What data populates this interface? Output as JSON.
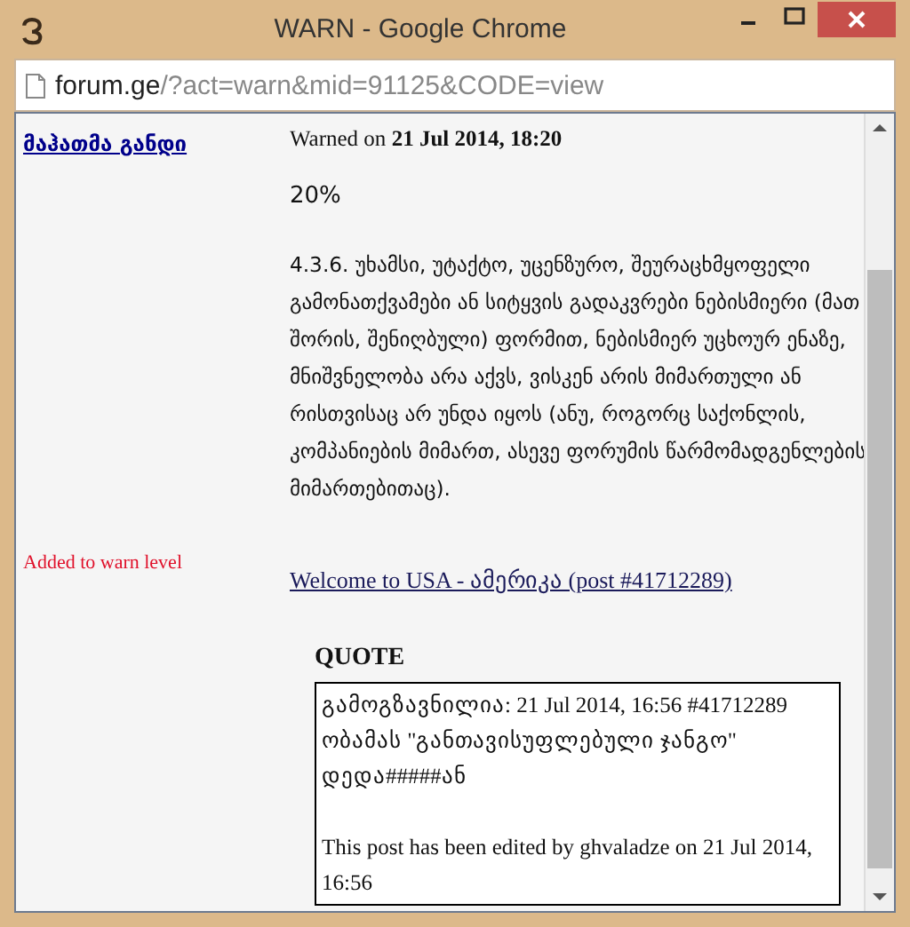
{
  "window": {
    "title": "WARN - Google Chrome"
  },
  "address_bar": {
    "domain": "forum.ge",
    "path": "/?act=warn&mid=91125&CODE=view"
  },
  "warning": {
    "user": "მაჰათმა განდი",
    "warned_label": "Warned on",
    "warned_date": "21 Jul 2014, 18:20",
    "level_text": "20%",
    "reason": "4.3.6. უხამსი, უტაქტო, უცენზურო, შეურაცხმყოფელი გამონათქვამები ან სიტყვის გადაკვრები ნებისმიერი (მათ შორის, შენიღბული) ფორმით, ნებისმიერ უცხოურ ენაზე, მნიშვნელობა არა აქვს, ვისკენ არის მიმართული ან რისთვისაც არ უნდა იყოს (ანუ, როგორც საქონლის, კომპანიების მიმართ, ასევე ფორუმის წარმომადგენლების მიმართებითაც).",
    "added_note": "Added to warn level",
    "post_link": "Welcome to USA - ამერიკა (post #41712289)",
    "quote": {
      "title": "QUOTE",
      "lines": [
        "გამოგზავნილია: 21 Jul 2014, 16:56  #41712289",
        "ობამას \"განთავისუფლებული ჯანგო\" დედა#####ან"
      ],
      "edit_note": "This post has been edited by ghvaladze on 21 Jul 2014, 16:56"
    }
  }
}
